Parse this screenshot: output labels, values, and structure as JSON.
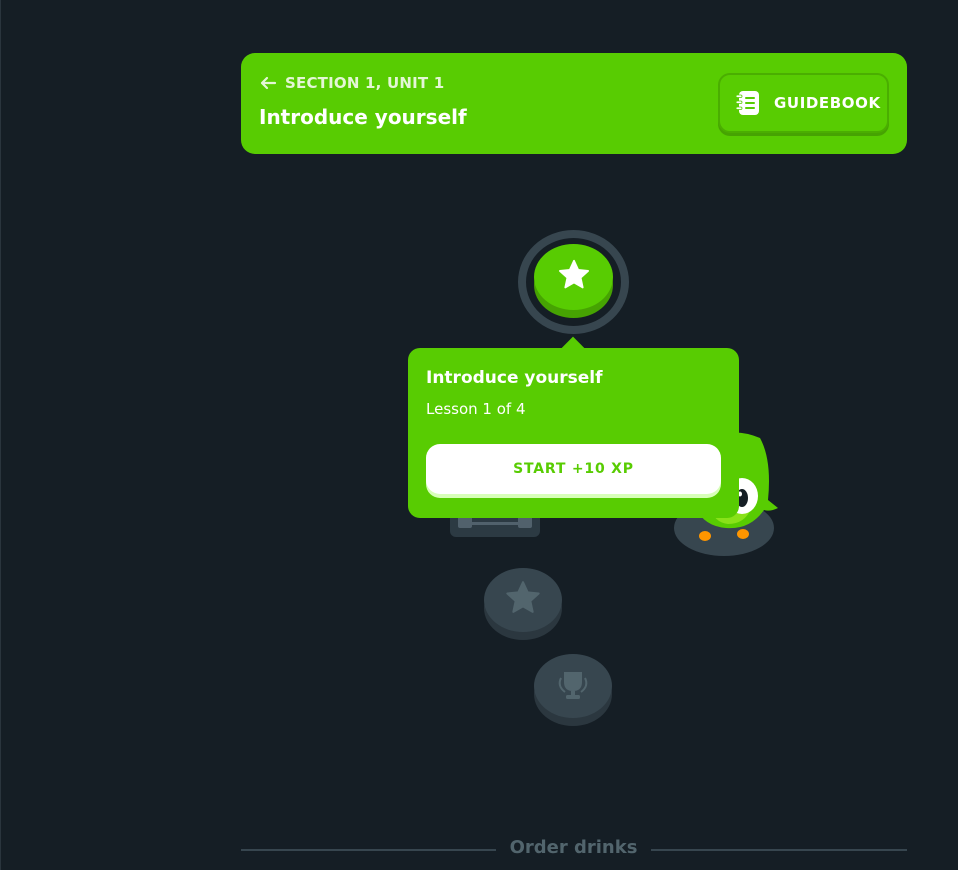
{
  "unit_header": {
    "section_label": "SECTION 1, UNIT 1",
    "unit_title": "Introduce yourself",
    "guidebook_label": "GUIDEBOOK",
    "back_icon": "arrow-left-icon",
    "guidebook_icon": "notebook-icon"
  },
  "tooltip": {
    "title": "Introduce yourself",
    "subtitle": "Lesson 1 of 4",
    "start_button_label": "START +10 XP"
  },
  "path": {
    "nodes": [
      {
        "state": "active",
        "icon": "star-icon"
      },
      {
        "state": "locked",
        "icon": "treasure-chest-icon"
      },
      {
        "state": "locked",
        "icon": "star-icon"
      },
      {
        "state": "locked",
        "icon": "trophy-icon"
      }
    ]
  },
  "next_unit": {
    "label": "Order drinks"
  },
  "colors": {
    "background": "#151e25",
    "accent_green": "#58cc02",
    "accent_green_dark": "#46a302",
    "locked_gray": "#37464f",
    "divider_text": "#52656d"
  }
}
